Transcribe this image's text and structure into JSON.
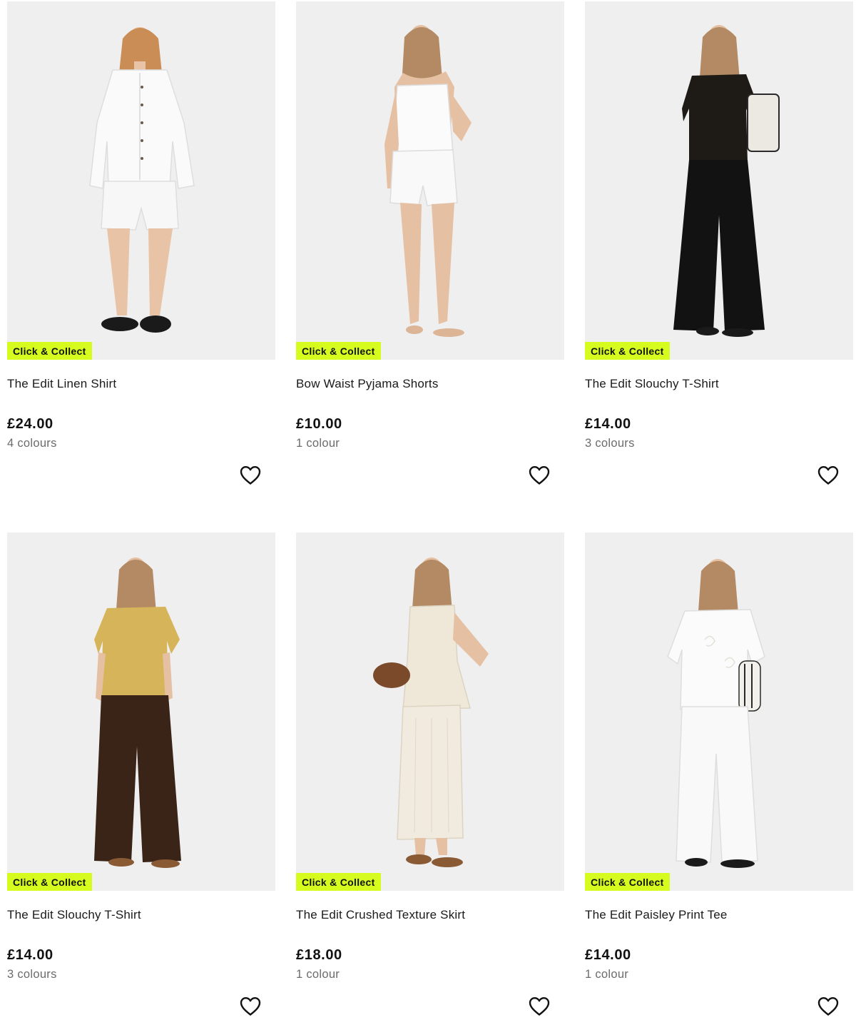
{
  "products": [
    {
      "title": "The Edit Linen Shirt",
      "price": "£24.00",
      "colours": "4 colours",
      "badge": "Click & Collect",
      "icon": "heart-outline-icon"
    },
    {
      "title": "Bow Waist Pyjama Shorts",
      "price": "£10.00",
      "colours": "1 colour",
      "badge": "Click & Collect",
      "icon": "heart-outline-icon"
    },
    {
      "title": "The Edit Slouchy T-Shirt",
      "price": "£14.00",
      "colours": "3 colours",
      "badge": "Click & Collect",
      "icon": "heart-outline-icon"
    },
    {
      "title": "The Edit Slouchy T-Shirt",
      "price": "£14.00",
      "colours": "3 colours",
      "badge": "Click & Collect",
      "icon": "heart-outline-icon"
    },
    {
      "title": "The Edit Crushed Texture Skirt",
      "price": "£18.00",
      "colours": "1 colour",
      "badge": "Click & Collect",
      "icon": "heart-outline-icon"
    },
    {
      "title": "The Edit Paisley Print Tee",
      "price": "£14.00",
      "colours": "1 colour",
      "badge": "Click & Collect",
      "icon": "heart-outline-icon"
    }
  ],
  "colors": {
    "badge_bg": "#d6fb1e",
    "image_bg": "#efefef",
    "price_text": "#111111",
    "muted_text": "#6b6b6b"
  }
}
